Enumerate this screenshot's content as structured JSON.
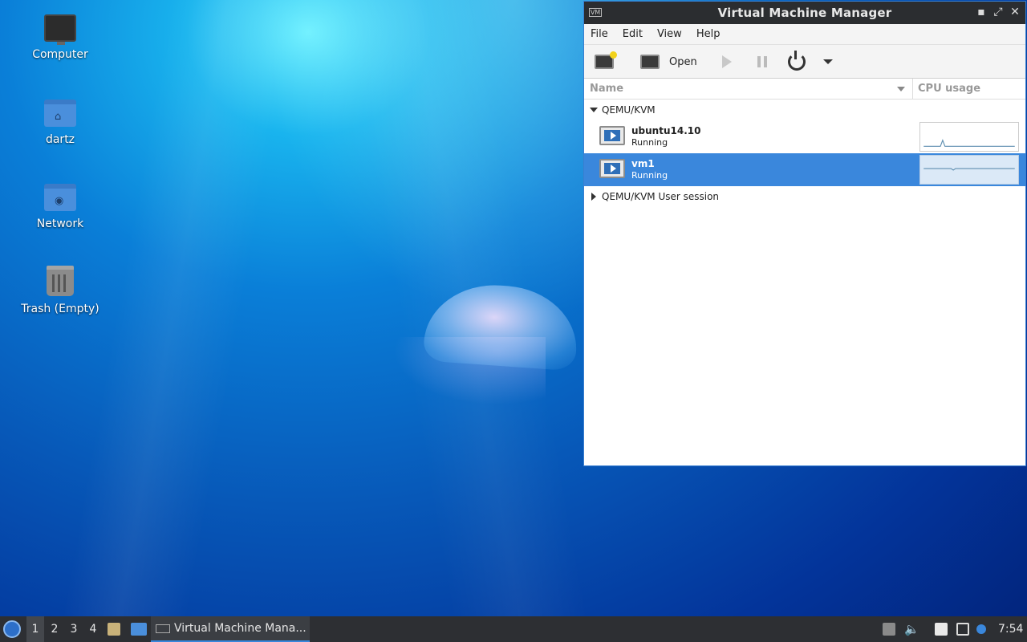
{
  "desktop": {
    "icons": [
      {
        "label": "Computer"
      },
      {
        "label": "dartz"
      },
      {
        "label": "Network"
      },
      {
        "label": "Trash (Empty)"
      }
    ]
  },
  "window": {
    "title": "Virtual Machine Manager",
    "controls": {
      "minimize": "▪",
      "maximize": "⤢",
      "close": "✕"
    },
    "menu": [
      "File",
      "Edit",
      "View",
      "Help"
    ],
    "toolbar": {
      "open_label": "Open"
    },
    "columns": {
      "name": "Name",
      "cpu": "CPU usage"
    },
    "groups": [
      {
        "label": "QEMU/KVM",
        "expanded": true,
        "vms": [
          {
            "name": "ubuntu14.10",
            "status": "Running",
            "selected": false
          },
          {
            "name": "vm1",
            "status": "Running",
            "selected": true
          }
        ]
      },
      {
        "label": "QEMU/KVM User session",
        "expanded": false,
        "vms": []
      }
    ]
  },
  "taskbar": {
    "workspaces": [
      "1",
      "2",
      "3",
      "4"
    ],
    "active_workspace": "1",
    "task_label": "Virtual Machine Mana...",
    "clock": "7:54"
  },
  "colors": {
    "selection": "#3a87dc",
    "titlebar": "#2b2d30",
    "taskbar": "#2d2f33"
  }
}
